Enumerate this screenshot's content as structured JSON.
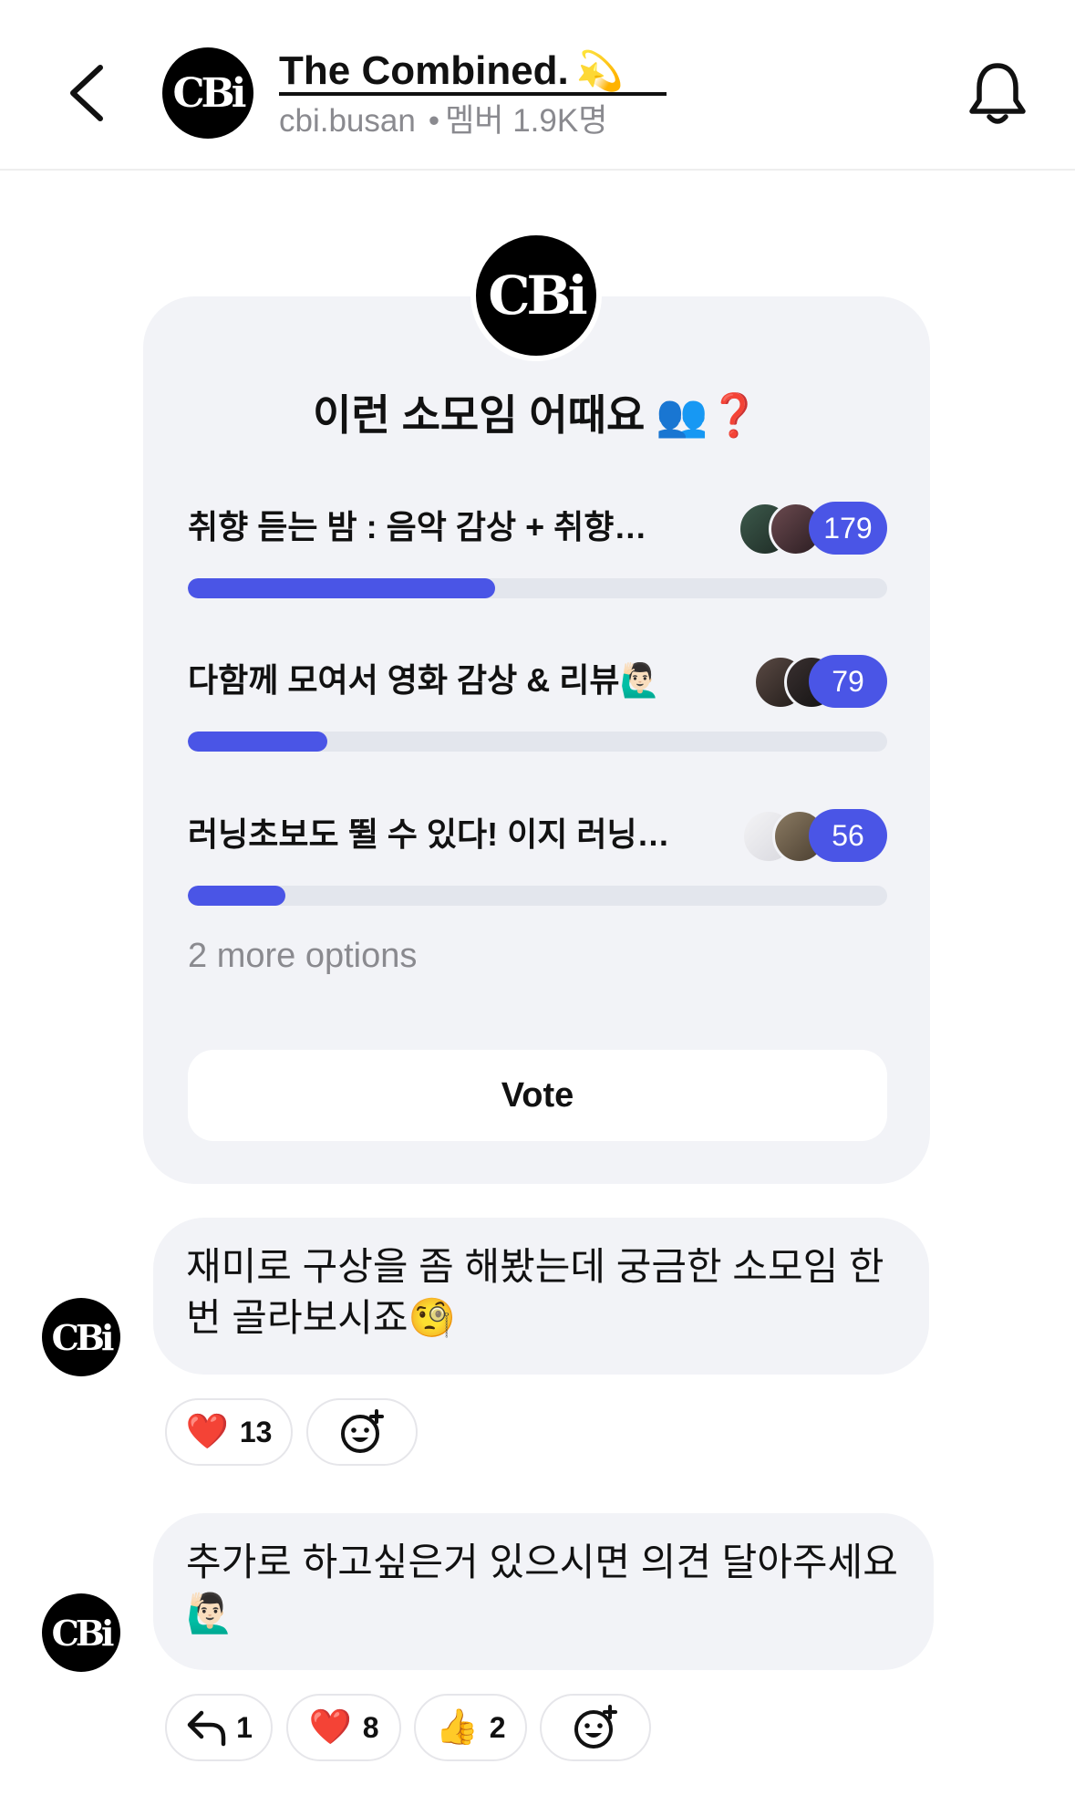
{
  "header": {
    "title": "The Combined.",
    "title_emoji": "💫",
    "handle": "cbi.busan",
    "separator": "•",
    "member_label": "멤버 1.9K명",
    "logo_text": "CBi"
  },
  "poll": {
    "question": "이런 소모임 어때요",
    "question_emoji": "👥❓",
    "options": [
      {
        "label": "취향 듣는 밤 : 음악 감상 + 취향…",
        "count": "179",
        "fraction": 0.44
      },
      {
        "label": "다함께 모여서 영화 감상 & 리뷰🙋🏻‍♂️",
        "count": "79",
        "fraction": 0.2
      },
      {
        "label": "러닝초보도 뛸 수 있다! 이지 러닝…",
        "count": "56",
        "fraction": 0.14
      }
    ],
    "more_options": "2 more options",
    "vote_label": "Vote"
  },
  "messages": [
    {
      "text_line1": "재미로 구상을 좀 해봤는데 궁금한 소모임 한",
      "text_line2": "번 골라보시죠🧐",
      "reactions": [
        {
          "emoji": "❤️",
          "count": "13"
        }
      ]
    },
    {
      "text_line1": "추가로 하고싶은거 있으시면 의견 달아주세요",
      "text_line2": "🙋🏻‍♂️",
      "replies": "1",
      "reactions": [
        {
          "emoji": "❤️",
          "count": "8"
        },
        {
          "emoji": "👍",
          "count": "2"
        }
      ]
    }
  ],
  "colors": {
    "accent": "#4a55e6",
    "card_bg": "#f2f3f7",
    "muted": "#8a8a8f"
  },
  "icons": [
    "back-chevron-icon",
    "bell-icon",
    "add-reaction-icon",
    "reply-icon"
  ]
}
